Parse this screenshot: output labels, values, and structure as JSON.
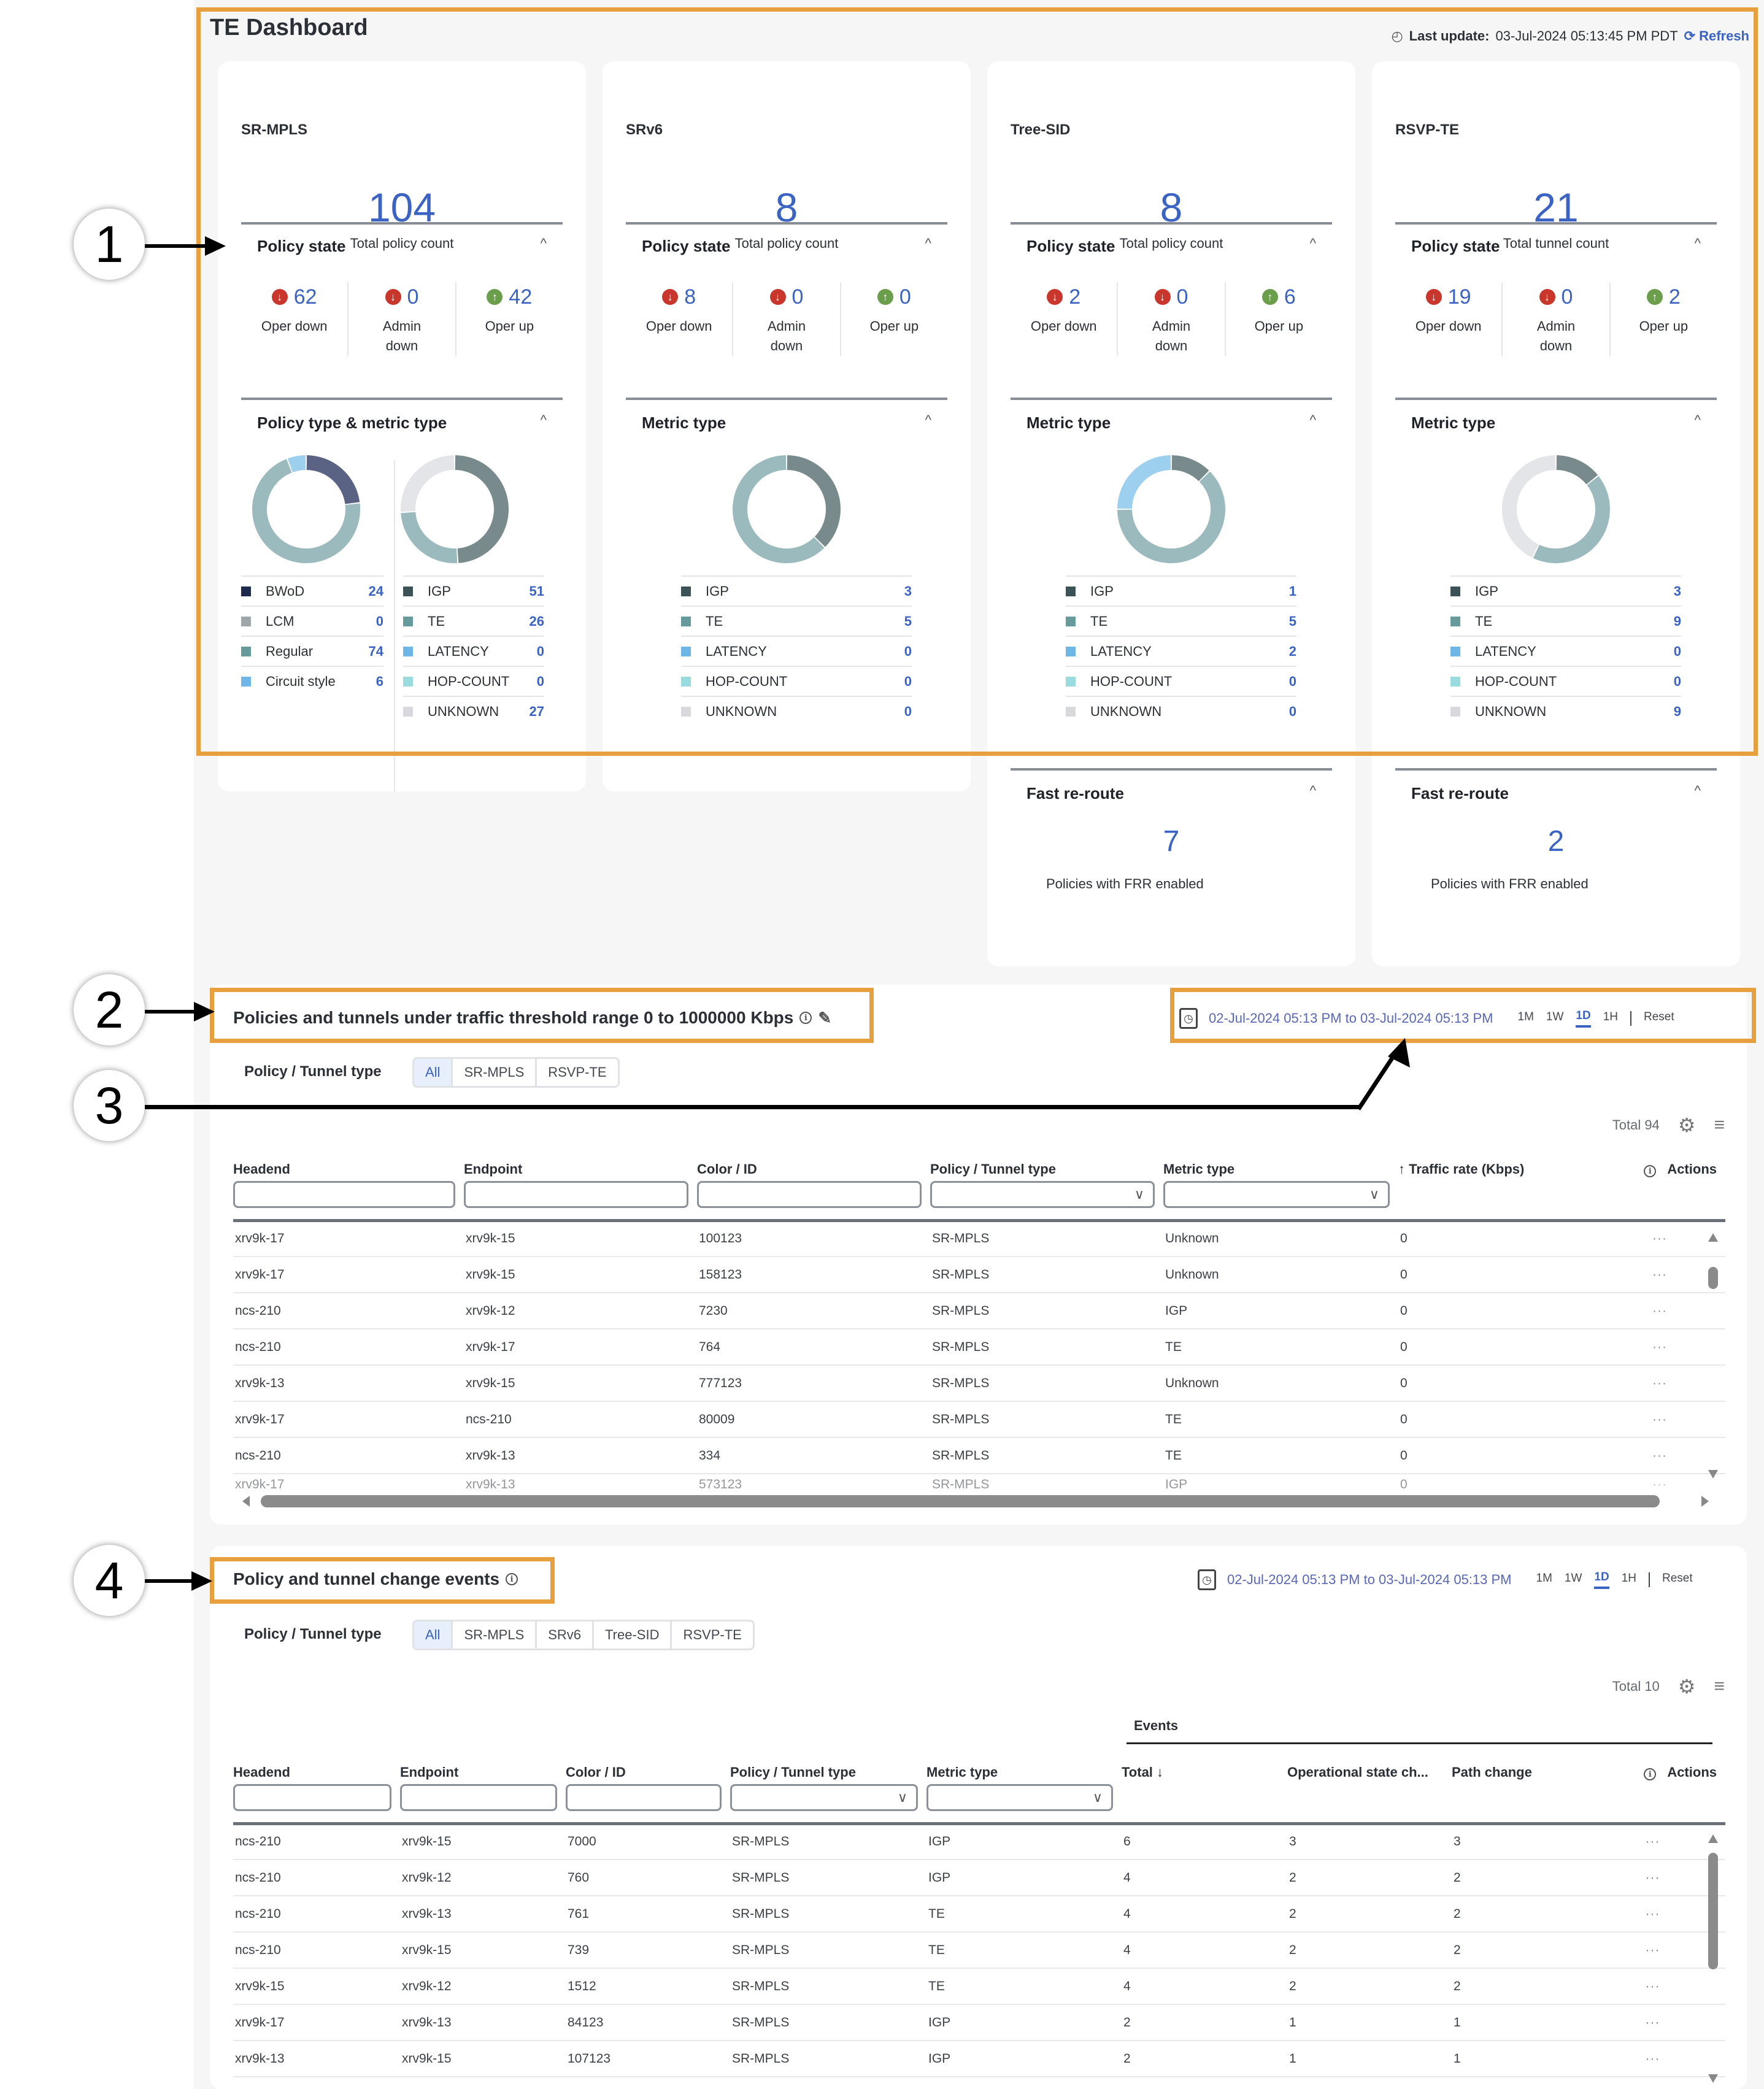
{
  "header": {
    "title": "TE Dashboard",
    "last_update_label": "Last update:",
    "last_update_value": "03-Jul-2024 05:13:45 PM PDT",
    "refresh_label": "Refresh"
  },
  "callouts": [
    "1",
    "2",
    "3",
    "4"
  ],
  "cards": [
    {
      "name": "SR-MPLS",
      "total": "104",
      "total_label": "Total policy count",
      "state_title": "Policy state",
      "states": [
        {
          "value": "62",
          "label": "Oper down",
          "dir": "down"
        },
        {
          "value": "0",
          "label": "Admin down",
          "dir": "down"
        },
        {
          "value": "42",
          "label": "Oper up",
          "dir": "up"
        }
      ],
      "breakdown_title": "Policy type & metric type",
      "policy_types": [
        {
          "label": "BWoD",
          "value": 24,
          "color": "#1d2a4d"
        },
        {
          "label": "LCM",
          "value": 0,
          "color": "#9ea6aa"
        },
        {
          "label": "Regular",
          "value": 74,
          "color": "#679a9b"
        },
        {
          "label": "Circuit style",
          "value": 6,
          "color": "#6eb6e6"
        }
      ],
      "metric_types": [
        {
          "label": "IGP",
          "value": 51,
          "color": "#3b5257"
        },
        {
          "label": "TE",
          "value": 26,
          "color": "#679a9b"
        },
        {
          "label": "LATENCY",
          "value": 0,
          "color": "#6eb6e6"
        },
        {
          "label": "HOP-COUNT",
          "value": 0,
          "color": "#99dbdf"
        },
        {
          "label": "UNKNOWN",
          "value": 27,
          "color": "#d7d9dd"
        }
      ]
    },
    {
      "name": "SRv6",
      "total": "8",
      "total_label": "Total policy count",
      "state_title": "Policy state",
      "states": [
        {
          "value": "8",
          "label": "Oper down",
          "dir": "down"
        },
        {
          "value": "0",
          "label": "Admin down",
          "dir": "down"
        },
        {
          "value": "0",
          "label": "Oper up",
          "dir": "up"
        }
      ],
      "breakdown_title": "Metric type",
      "metric_types": [
        {
          "label": "IGP",
          "value": 3,
          "color": "#3b5257"
        },
        {
          "label": "TE",
          "value": 5,
          "color": "#679a9b"
        },
        {
          "label": "LATENCY",
          "value": 0,
          "color": "#6eb6e6"
        },
        {
          "label": "HOP-COUNT",
          "value": 0,
          "color": "#99dbdf"
        },
        {
          "label": "UNKNOWN",
          "value": 0,
          "color": "#d7d9dd"
        }
      ]
    },
    {
      "name": "Tree-SID",
      "total": "8",
      "total_label": "Total policy count",
      "state_title": "Policy state",
      "states": [
        {
          "value": "2",
          "label": "Oper down",
          "dir": "down"
        },
        {
          "value": "0",
          "label": "Admin down",
          "dir": "down"
        },
        {
          "value": "6",
          "label": "Oper up",
          "dir": "up"
        }
      ],
      "breakdown_title": "Metric type",
      "metric_types": [
        {
          "label": "IGP",
          "value": 1,
          "color": "#3b5257"
        },
        {
          "label": "TE",
          "value": 5,
          "color": "#679a9b"
        },
        {
          "label": "LATENCY",
          "value": 2,
          "color": "#6eb6e6"
        },
        {
          "label": "HOP-COUNT",
          "value": 0,
          "color": "#99dbdf"
        },
        {
          "label": "UNKNOWN",
          "value": 0,
          "color": "#d7d9dd"
        }
      ],
      "frr": {
        "title": "Fast re-route",
        "value": "7",
        "label": "Policies with FRR enabled"
      }
    },
    {
      "name": "RSVP-TE",
      "total": "21",
      "total_label": "Total tunnel count",
      "state_title": "Policy state",
      "states": [
        {
          "value": "19",
          "label": "Oper down",
          "dir": "down"
        },
        {
          "value": "0",
          "label": "Admin down",
          "dir": "down"
        },
        {
          "value": "2",
          "label": "Oper up",
          "dir": "up"
        }
      ],
      "breakdown_title": "Metric type",
      "metric_types": [
        {
          "label": "IGP",
          "value": 3,
          "color": "#3b5257"
        },
        {
          "label": "TE",
          "value": 9,
          "color": "#679a9b"
        },
        {
          "label": "LATENCY",
          "value": 0,
          "color": "#6eb6e6"
        },
        {
          "label": "HOP-COUNT",
          "value": 0,
          "color": "#99dbdf"
        },
        {
          "label": "UNKNOWN",
          "value": 9,
          "color": "#d7d9dd"
        }
      ],
      "frr": {
        "title": "Fast re-route",
        "value": "2",
        "label": "Policies with FRR enabled"
      }
    }
  ],
  "donut_palette": {
    "policy": {
      "BWoD": "#5b6384",
      "LCM": "#9ea6aa",
      "Regular": "#9bbabd",
      "Circuit style": "#9dd0ee"
    },
    "metric": {
      "IGP": "#788a8c",
      "TE": "#9bbabd",
      "LATENCY": "#9dd0ee",
      "HOP-COUNT": "#b5e4e6",
      "UNKNOWN": "#e4e5e9"
    }
  },
  "traffic": {
    "title": "Policies and tunnels under traffic threshold range 0 to 1000000 Kbps",
    "filter_label": "Policy / Tunnel type",
    "filters": [
      "All",
      "SR-MPLS",
      "RSVP-TE"
    ],
    "active_filter": "All",
    "date_range": "02-Jul-2024 05:13 PM to 03-Jul-2024 05:13 PM",
    "ranges": [
      "1M",
      "1W",
      "1D",
      "1H"
    ],
    "active_range": "1D",
    "reset_label": "Reset",
    "total_label": "Total 94",
    "columns": [
      "Headend",
      "Endpoint",
      "Color / ID",
      "Policy / Tunnel type",
      "Metric type",
      "↑ Traffic rate (Kbps)",
      "Actions"
    ],
    "rows": [
      [
        "xrv9k-17",
        "xrv9k-15",
        "100123",
        "SR-MPLS",
        "Unknown",
        "0"
      ],
      [
        "xrv9k-17",
        "xrv9k-15",
        "158123",
        "SR-MPLS",
        "Unknown",
        "0"
      ],
      [
        "ncs-210",
        "xrv9k-12",
        "7230",
        "SR-MPLS",
        "IGP",
        "0"
      ],
      [
        "ncs-210",
        "xrv9k-17",
        "764",
        "SR-MPLS",
        "TE",
        "0"
      ],
      [
        "xrv9k-13",
        "xrv9k-15",
        "777123",
        "SR-MPLS",
        "Unknown",
        "0"
      ],
      [
        "xrv9k-17",
        "ncs-210",
        "80009",
        "SR-MPLS",
        "TE",
        "0"
      ],
      [
        "ncs-210",
        "xrv9k-13",
        "334",
        "SR-MPLS",
        "TE",
        "0"
      ],
      [
        "xrv9k-17",
        "xrv9k-13",
        "573123",
        "SR-MPLS",
        "IGP",
        "0"
      ]
    ]
  },
  "events": {
    "title": "Policy and tunnel change events",
    "filter_label": "Policy / Tunnel type",
    "filters": [
      "All",
      "SR-MPLS",
      "SRv6",
      "Tree-SID",
      "RSVP-TE"
    ],
    "active_filter": "All",
    "date_range": "02-Jul-2024 05:13 PM to 03-Jul-2024 05:13 PM",
    "ranges": [
      "1M",
      "1W",
      "1D",
      "1H"
    ],
    "active_range": "1D",
    "reset_label": "Reset",
    "total_label": "Total 10",
    "group_label": "Events",
    "columns": [
      "Headend",
      "Endpoint",
      "Color / ID",
      "Policy / Tunnel type",
      "Metric type",
      "Total ↓",
      "Operational state ch...",
      "Path change",
      "Actions"
    ],
    "rows": [
      [
        "ncs-210",
        "xrv9k-15",
        "7000",
        "SR-MPLS",
        "IGP",
        "6",
        "3",
        "3"
      ],
      [
        "ncs-210",
        "xrv9k-12",
        "760",
        "SR-MPLS",
        "IGP",
        "4",
        "2",
        "2"
      ],
      [
        "ncs-210",
        "xrv9k-13",
        "761",
        "SR-MPLS",
        "TE",
        "4",
        "2",
        "2"
      ],
      [
        "ncs-210",
        "xrv9k-15",
        "739",
        "SR-MPLS",
        "TE",
        "4",
        "2",
        "2"
      ],
      [
        "xrv9k-15",
        "xrv9k-12",
        "1512",
        "SR-MPLS",
        "TE",
        "4",
        "2",
        "2"
      ],
      [
        "xrv9k-17",
        "xrv9k-13",
        "84123",
        "SR-MPLS",
        "IGP",
        "2",
        "1",
        "1"
      ],
      [
        "xrv9k-13",
        "xrv9k-15",
        "107123",
        "SR-MPLS",
        "IGP",
        "2",
        "1",
        "1"
      ]
    ]
  },
  "actions_glyph": "···"
}
